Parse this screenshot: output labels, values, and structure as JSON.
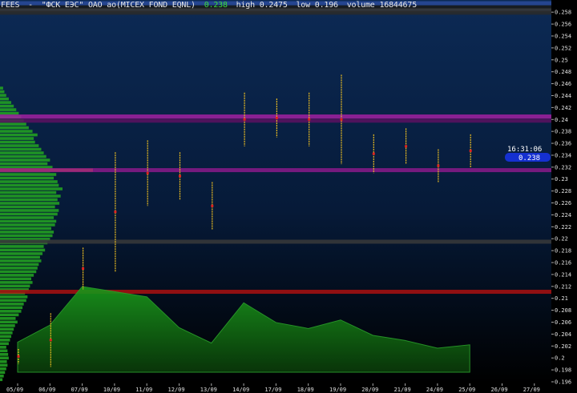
{
  "header": {
    "ticker": "FEES",
    "name": "\"ФСК ЕЭС\" ОАО ао(MICEX FOND EQNL)",
    "last": "0.238",
    "high_label": "high 0.2475",
    "low_label": "low 0.196",
    "volume_label": "volume 16844675"
  },
  "cursor": {
    "time": "16:31:06",
    "price": "0.238"
  },
  "colors": {
    "background_top": "#0c2a55",
    "background_bottom": "#000000",
    "candle": "#f0c020",
    "volume_fill": "#1a8c1a",
    "profile": "#22a022",
    "profile_max": "#ff8c00",
    "level_purple": "#a020a0",
    "level_red": "#aa1010",
    "level_blue": "#2a4a9a",
    "price_label_bg": "#1530d0"
  },
  "chart_data": {
    "type": "line",
    "title": "",
    "xlabel": "",
    "ylabel": "",
    "x_ticks": [
      "05/09",
      "06/09",
      "07/09",
      "10/09",
      "11/09",
      "12/09",
      "13/09",
      "14/09",
      "17/09",
      "18/09",
      "19/09",
      "20/09",
      "21/09",
      "24/09",
      "25/09",
      "26/09",
      "27/09"
    ],
    "y_ticks": [
      "0.196",
      "0.198",
      "0.2",
      "0.202",
      "0.204",
      "0.206",
      "0.208",
      "0.21",
      "0.212",
      "0.214",
      "0.216",
      "0.218",
      "0.22",
      "0.222",
      "0.224",
      "0.226",
      "0.228",
      "0.23",
      "0.232",
      "0.234",
      "0.236",
      "0.238",
      "0.24",
      "0.242",
      "0.244",
      "0.246",
      "0.248",
      "0.25",
      "0.252",
      "0.254",
      "0.256",
      "0.258"
    ],
    "y_range": [
      0.196,
      0.2595
    ],
    "series": [
      {
        "type": "ohlc",
        "points": [
          {
            "date": "05/09",
            "high": 0.2015,
            "low": 0.199
          },
          {
            "date": "06/09",
            "high": 0.2075,
            "low": 0.1985
          },
          {
            "date": "07/09",
            "high": 0.2185,
            "low": 0.2115
          },
          {
            "date": "10/09",
            "high": 0.2345,
            "low": 0.2145
          },
          {
            "date": "11/09",
            "high": 0.2365,
            "low": 0.2255
          },
          {
            "date": "12/09",
            "high": 0.2345,
            "low": 0.2265
          },
          {
            "date": "13/09",
            "high": 0.2295,
            "low": 0.2215
          },
          {
            "date": "14/09",
            "high": 0.2445,
            "low": 0.2355
          },
          {
            "date": "17/09",
            "high": 0.2435,
            "low": 0.237
          },
          {
            "date": "18/09",
            "high": 0.2445,
            "low": 0.2355
          },
          {
            "date": "19/09",
            "high": 0.2475,
            "low": 0.2325
          },
          {
            "date": "20/09",
            "high": 0.2375,
            "low": 0.231
          },
          {
            "date": "21/09",
            "high": 0.2385,
            "low": 0.2325
          },
          {
            "date": "24/09",
            "high": 0.235,
            "low": 0.2295
          },
          {
            "date": "25/09",
            "high": 0.2375,
            "low": 0.232
          }
        ]
      },
      {
        "type": "volume",
        "points": [
          {
            "date": "05/09",
            "value": 35
          },
          {
            "date": "06/09",
            "value": 55
          },
          {
            "date": "07/09",
            "value": 100
          },
          {
            "date": "10/09",
            "value": 94
          },
          {
            "date": "11/09",
            "value": 88
          },
          {
            "date": "12/09",
            "value": 52
          },
          {
            "date": "13/09",
            "value": 34
          },
          {
            "date": "14/09",
            "value": 81
          },
          {
            "date": "17/09",
            "value": 58
          },
          {
            "date": "18/09",
            "value": 51
          },
          {
            "date": "19/09",
            "value": 61
          },
          {
            "date": "20/09",
            "value": 43
          },
          {
            "date": "21/09",
            "value": 37
          },
          {
            "date": "24/09",
            "value": 28
          },
          {
            "date": "25/09",
            "value": 32
          }
        ]
      }
    ],
    "levels": [
      {
        "price": 0.2595,
        "color": "#2a4a9a"
      },
      {
        "price": 0.2588,
        "color": "#1a1a1a"
      },
      {
        "price": 0.2583,
        "color": "#3a3a3a"
      },
      {
        "price": 0.2579,
        "color": "#2a2a2a"
      },
      {
        "price": 0.2405,
        "color": "#a020a0"
      },
      {
        "price": 0.2398,
        "color": "#5a1060"
      },
      {
        "price": 0.2315,
        "color": "#8a1a8a"
      },
      {
        "price": 0.2195,
        "color": "#3a3a3a"
      },
      {
        "price": 0.2111,
        "color": "#aa1010"
      }
    ],
    "volume_profile": {
      "price_low": 0.196,
      "price_high": 0.2455,
      "max_price": 0.2315,
      "weights": [
        0.04,
        0.06,
        0.08,
        0.1,
        0.12,
        0.11,
        0.14,
        0.13,
        0.12,
        0.1,
        0.14,
        0.16,
        0.18,
        0.2,
        0.22,
        0.24,
        0.28,
        0.25,
        0.3,
        0.34,
        0.36,
        0.38,
        0.42,
        0.44,
        0.4,
        0.46,
        0.48,
        0.52,
        0.5,
        0.54,
        0.58,
        0.6,
        0.62,
        0.66,
        0.64,
        0.68,
        0.72,
        0.7,
        0.76,
        0.8,
        0.84,
        0.86,
        0.82,
        0.88,
        0.9,
        0.86,
        0.92,
        0.94,
        0.88,
        0.95,
        0.92,
        0.97,
        0.9,
        1.0,
        0.94,
        0.92,
        0.86,
        0.9,
        0.8,
        0.84,
        0.76,
        0.8,
        0.74,
        0.7,
        0.66,
        0.62,
        0.56,
        0.54,
        0.6,
        0.52,
        0.46,
        0.42,
        0.38,
        0.34,
        0.3,
        0.26,
        0.22,
        0.18,
        0.14,
        0.1,
        0.07,
        0.05
      ]
    }
  }
}
